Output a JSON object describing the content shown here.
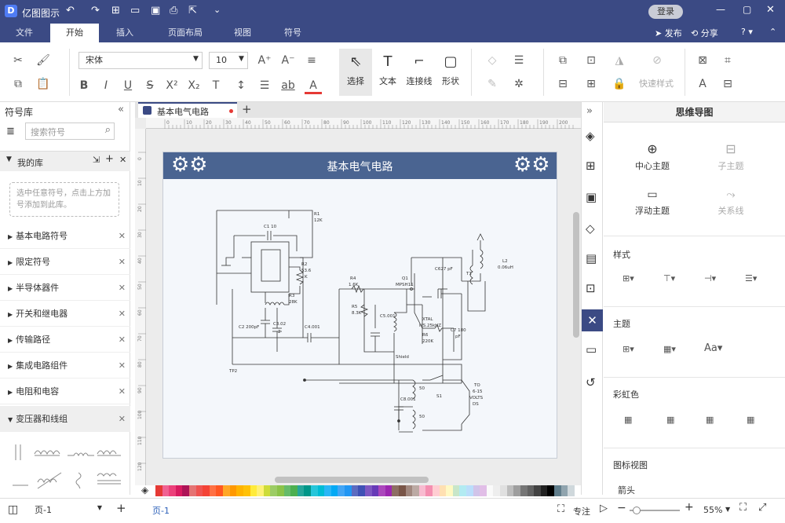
{
  "app": {
    "title": "亿图图示",
    "login": "登录"
  },
  "menu_tabs": [
    "文件",
    "开始",
    "插入",
    "页面布局",
    "视图",
    "符号"
  ],
  "share": {
    "publish": "发布",
    "share": "分享"
  },
  "ribbon": {
    "font_name": "宋体",
    "font_size": "10",
    "select": "选择",
    "text": "文本",
    "connector": "连接线",
    "shape": "形状",
    "quick_style": "快速样式"
  },
  "left_panel": {
    "title": "符号库",
    "search_placeholder": "搜索符号",
    "my_lib": "我的库",
    "my_lib_hint": "选中任意符号，点击上方加号添加到此库。",
    "items": [
      "基本电路符号",
      "限定符号",
      "半导体器件",
      "开关和继电器",
      "传输路径",
      "集成电路组件",
      "电阻和电容",
      "变压器和线组"
    ]
  },
  "doc_tab": "基本电气电路",
  "diagram": {
    "title": "基本电气电路",
    "labels": {
      "r1": "R1",
      "r1v": "12K",
      "c1": "C1 10",
      "r2": "R2",
      "r2v": "53.6",
      "r2k": "K",
      "r3": "R3",
      "r3v": "28K",
      "c2": "C2 200pF",
      "c3": "C3.02",
      "c3b": "2",
      "c4": "C4.001",
      "tp2": "TP2",
      "r4": "R4",
      "r4v": "1.6K",
      "r5": "R5",
      "r5v": "8.3K",
      "c5": "C5.001",
      "q1": "Q1",
      "q1v": "MPSH11",
      "c6": "C627 pF",
      "t1": "T1",
      "l2": "L2",
      "l2v": "0.06uH",
      "xtal": "XTAL",
      "xtalv": "MS.25kHZ",
      "r6": "R6",
      "r6v": "220K",
      "c7": "C7 180",
      "c7b": "pF",
      "shield": "Shield",
      "c8": "C8.001",
      "s1": "S1",
      "to": "TO",
      "to2": "6-15",
      "to3": "VOLTS",
      "to4": "DS",
      "uh1": "50",
      "uh2": "50"
    },
    "ruler_h": [
      "0",
      "10",
      "20",
      "30",
      "40",
      "50",
      "60",
      "70",
      "80",
      "90",
      "100",
      "110",
      "120",
      "130",
      "140",
      "150",
      "160",
      "170",
      "180",
      "190",
      "200"
    ],
    "ruler_v": [
      "0",
      "10",
      "20",
      "30",
      "40",
      "50",
      "60",
      "70",
      "80",
      "90",
      "100",
      "110",
      "120"
    ]
  },
  "right_panel": {
    "title": "思维导图",
    "center_topic": "中心主题",
    "sub_topic": "子主题",
    "float_topic": "浮动主题",
    "relation": "关系线",
    "style": "样式",
    "theme": "主题",
    "rainbow": "彩虹色",
    "icon_view": "图标视图",
    "arrow": "箭头"
  },
  "status": {
    "page_select": "页-1",
    "page_tab": "页-1",
    "focus": "专注",
    "zoom": "55%"
  },
  "colors": {
    "titlebar": "#3b4a84",
    "diagram_header": "#4a6491",
    "accent": "#2b5fb8"
  },
  "palette": [
    "#e53935",
    "#f06292",
    "#ec407a",
    "#d81b60",
    "#ad1457",
    "#e57373",
    "#ef5350",
    "#f44336",
    "#ff7043",
    "#ff5722",
    "#ffa726",
    "#ff9800",
    "#ffb300",
    "#ffc107",
    "#ffeb3b",
    "#fff176",
    "#cddc39",
    "#9ccc65",
    "#8bc34a",
    "#66bb6a",
    "#4caf50",
    "#26a69a",
    "#009688",
    "#26c6da",
    "#00bcd4",
    "#29b6f6",
    "#03a9f4",
    "#42a5f5",
    "#2196f3",
    "#5c6bc0",
    "#3f51b5",
    "#7e57c2",
    "#673ab7",
    "#ab47bc",
    "#9c27b0",
    "#8d6e63",
    "#795548",
    "#a1887f",
    "#bcaaa4",
    "#f8bbd0",
    "#f48fb1",
    "#ffcdd2",
    "#ffe0b2",
    "#fff9c4",
    "#c8e6c9",
    "#b2ebf2",
    "#bbdefb",
    "#d1c4e9",
    "#e1bee7",
    "#fafafa",
    "#eeeeee",
    "#e0e0e0",
    "#bdbdbd",
    "#9e9e9e",
    "#757575",
    "#616161",
    "#424242",
    "#212121",
    "#000000",
    "#607d8b",
    "#90a4ae",
    "#cfd8dc"
  ]
}
